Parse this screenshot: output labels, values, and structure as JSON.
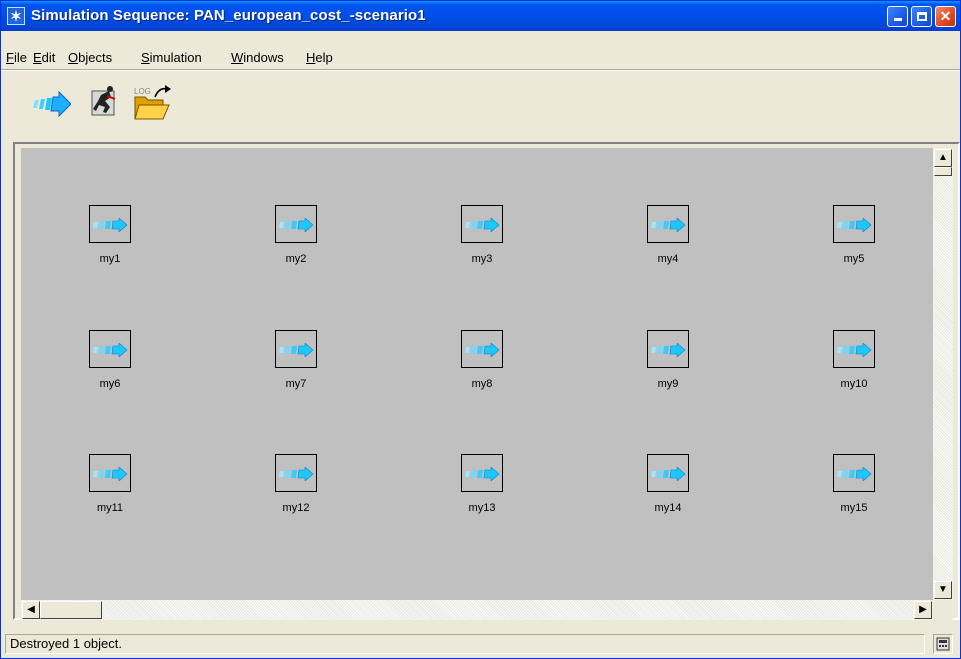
{
  "window": {
    "title": "Simulation Sequence: PAN_european_cost_-scenario1",
    "title_icon": "asterisk-app-icon",
    "caption_buttons": {
      "minimize": "minimize-icon",
      "maximize": "maximize-icon",
      "close": "close-icon"
    }
  },
  "menu": {
    "file": "File",
    "edit": "Edit",
    "objects": "Objects",
    "simulation": "Simulation",
    "windows": "Windows",
    "help": "Help"
  },
  "toolbar": {
    "run_icon": "run-simulation-arrow-icon",
    "runner_icon": "runner-icon",
    "open_log_icon": "open-log-folder-icon",
    "open_log_caption": "LOG"
  },
  "objects": [
    {
      "label": "my1"
    },
    {
      "label": "my2"
    },
    {
      "label": "my3"
    },
    {
      "label": "my4"
    },
    {
      "label": "my5"
    },
    {
      "label": "my6"
    },
    {
      "label": "my7"
    },
    {
      "label": "my8"
    },
    {
      "label": "my9"
    },
    {
      "label": "my10"
    },
    {
      "label": "my11"
    },
    {
      "label": "my12"
    },
    {
      "label": "my13"
    },
    {
      "label": "my14"
    },
    {
      "label": "my15"
    }
  ],
  "status": {
    "text": "Destroyed 1 object.",
    "icon": "status-panel-icon"
  },
  "colors": {
    "titlebar": "#0053ee",
    "canvas_bg": "#c0c0c0",
    "arrow": "#1ec8ff",
    "window_bg": "#ece9d8"
  }
}
